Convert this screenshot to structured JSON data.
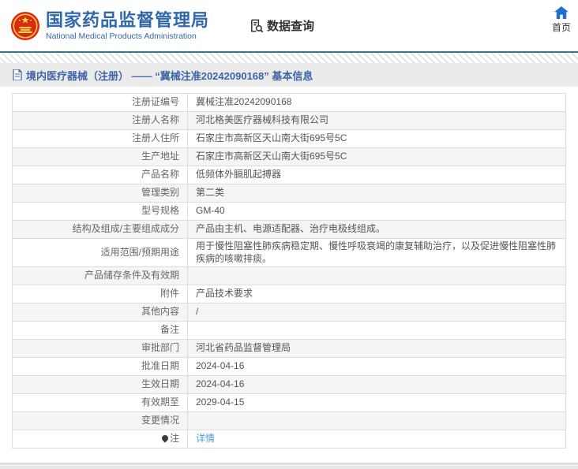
{
  "header": {
    "agency_cn": "国家药品监督管理局",
    "agency_en": "National Medical Products Administration",
    "nav_data_query": "数据查询",
    "home_label": "首页"
  },
  "title_bar": {
    "text": "境内医疗器械（注册） —— “冀械注准20242090168” 基本信息"
  },
  "table": {
    "rows": [
      {
        "label": "注册证编号",
        "value": "冀械注准20242090168"
      },
      {
        "label": "注册人名称",
        "value": "河北格美医疗器械科技有限公司"
      },
      {
        "label": "注册人住所",
        "value": "石家庄市高新区天山南大街695号5C"
      },
      {
        "label": "生产地址",
        "value": "石家庄市高新区天山南大街695号5C"
      },
      {
        "label": "产品名称",
        "value": "低频体外膈肌起搏器"
      },
      {
        "label": "管理类别",
        "value": "第二类"
      },
      {
        "label": "型号规格",
        "value": "GM-40"
      },
      {
        "label": "结构及组成/主要组成成分",
        "value": "产品由主机、电源适配器、治疗电极线组成。"
      },
      {
        "label": "适用范围/预期用途",
        "value": "用于慢性阻塞性肺疾病稳定期、慢性呼吸衰竭的康复辅助治疗，以及促进慢性阻塞性肺疾病的咳嗽排痰。"
      },
      {
        "label": "产品储存条件及有效期",
        "value": ""
      },
      {
        "label": "附件",
        "value": "产品技术要求"
      },
      {
        "label": "其他内容",
        "value": "/"
      },
      {
        "label": "备注",
        "value": ""
      },
      {
        "label": "审批部门",
        "value": "河北省药品监督管理局"
      },
      {
        "label": "批准日期",
        "value": "2024-04-16"
      },
      {
        "label": "生效日期",
        "value": "2024-04-16"
      },
      {
        "label": "有效期至",
        "value": "2029-04-15"
      },
      {
        "label": "变更情况",
        "value": ""
      },
      {
        "label": "注",
        "value": "详情",
        "icon": "pin",
        "link": true
      }
    ]
  },
  "colors": {
    "agency_blue": "#2f68ad",
    "header_rule_teal": "#2a7a96",
    "title_bar_bg": "#ebebeb",
    "title_bar_text": "#3c64a6",
    "link_blue": "#4a9bdb",
    "row_alt_bg": "#f5f5f5",
    "border_gray": "#dcdcdc",
    "emblem_red": "#de2910",
    "emblem_gold": "#f7d948",
    "home_icon_blue": "#1f6fd0"
  }
}
